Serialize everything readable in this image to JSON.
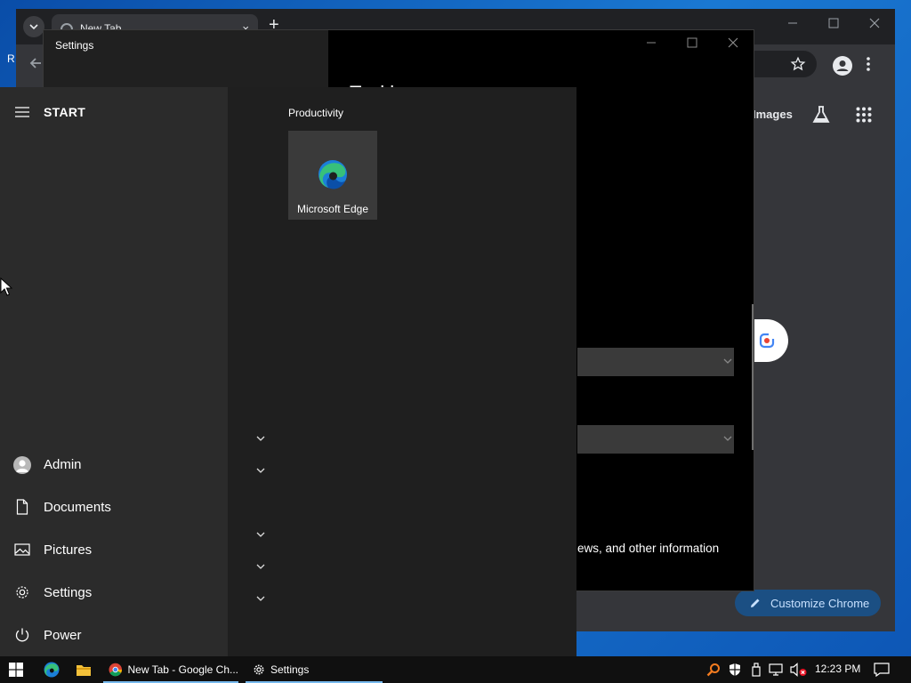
{
  "desktop": {
    "stray_text": "R"
  },
  "chrome": {
    "tab_title": "New Tab",
    "tab_close": "×",
    "new_tab": "+",
    "images_link": "Images",
    "customize_label": "Customize Chrome",
    "accent": "#8ab4f8"
  },
  "settings": {
    "window_title": "Settings",
    "heading": "Taskbar",
    "info_text": "ews, and other information"
  },
  "start": {
    "title": "START",
    "rail": [
      {
        "label": "Admin",
        "icon": "user-avatar-icon"
      },
      {
        "label": "Documents",
        "icon": "document-icon"
      },
      {
        "label": "Pictures",
        "icon": "pictures-icon"
      },
      {
        "label": "Settings",
        "icon": "gear-icon"
      },
      {
        "label": "Power",
        "icon": "power-icon"
      }
    ],
    "group_label": "Productivity",
    "tile": {
      "label": "Microsoft Edge",
      "icon": "edge-icon"
    }
  },
  "taskbar": {
    "apps": [
      {
        "label": "New Tab - Google Ch...",
        "icon": "chrome-icon"
      },
      {
        "label": "Settings",
        "icon": "gear-icon"
      }
    ],
    "clock": "12:23 PM"
  }
}
